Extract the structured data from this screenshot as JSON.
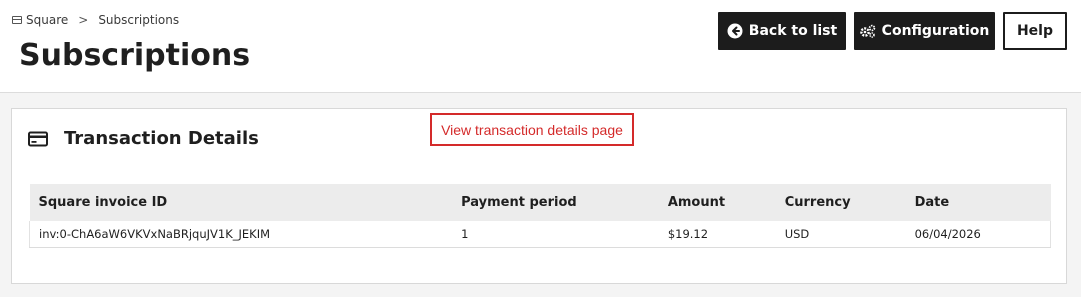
{
  "breadcrumb": {
    "root_label": "Square",
    "separator": ">",
    "current_label": "Subscriptions"
  },
  "page": {
    "title": "Subscriptions"
  },
  "toolbar": {
    "back_label": "Back to list",
    "config_label": "Configuration",
    "help_label": "Help"
  },
  "card": {
    "title": "Transaction Details",
    "annotation": "View transaction details page"
  },
  "table": {
    "columns": [
      "Square invoice ID",
      "Payment period",
      "Amount",
      "Currency",
      "Date"
    ],
    "rows": [
      [
        "inv:0-ChA6aW6VKVxNaBRjquJV1K_JEKIM",
        "1",
        "$19.12",
        "USD",
        "06/04/2026"
      ]
    ]
  },
  "colors": {
    "primary_button": "#1c1c1c",
    "annotation": "#d42a2a",
    "table_header": "#ececec"
  },
  "icons": {
    "breadcrumb": "window-icon",
    "back": "arrow-left-circle-icon",
    "config": "gears-icon",
    "card": "credit-card-icon"
  }
}
